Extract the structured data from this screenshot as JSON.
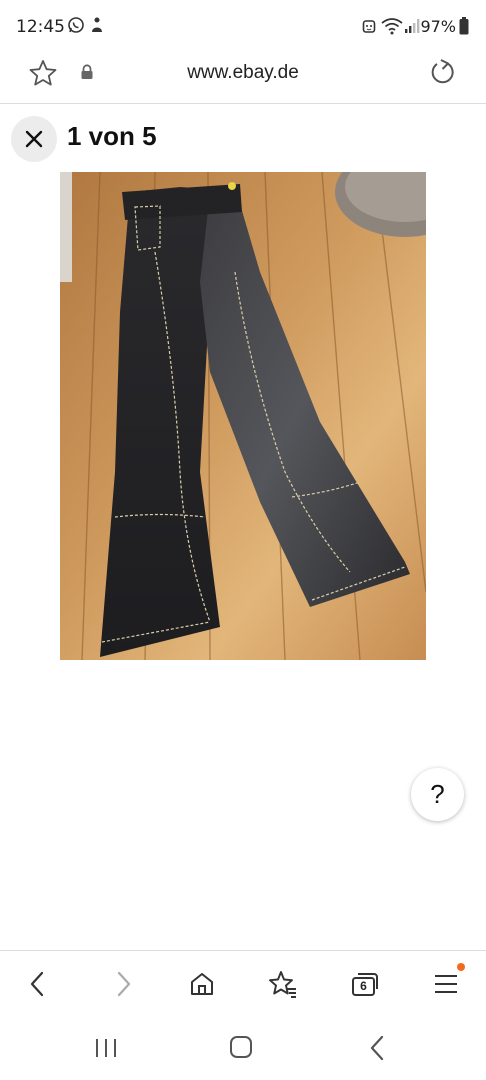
{
  "status_bar": {
    "time": "12:45",
    "battery": "97%",
    "left_icons": [
      "whatsapp-icon",
      "notification-icon"
    ],
    "right_icons": [
      "alarm-icon",
      "wifi-icon",
      "signal-icon",
      "battery-icon"
    ]
  },
  "browser": {
    "url": "www.ebay.de",
    "tab_count": "6"
  },
  "viewer": {
    "title": "1 von 5",
    "close_icon": "close-icon",
    "help_label": "?"
  },
  "toolbar": {
    "items": [
      "back-icon",
      "forward-icon",
      "home-icon",
      "bookmarks-icon",
      "tabs-icon",
      "menu-icon"
    ]
  },
  "colors": {
    "accent_dot": "#f26b1d",
    "divider": "#dcdcdc",
    "close_bg": "#ececec"
  }
}
